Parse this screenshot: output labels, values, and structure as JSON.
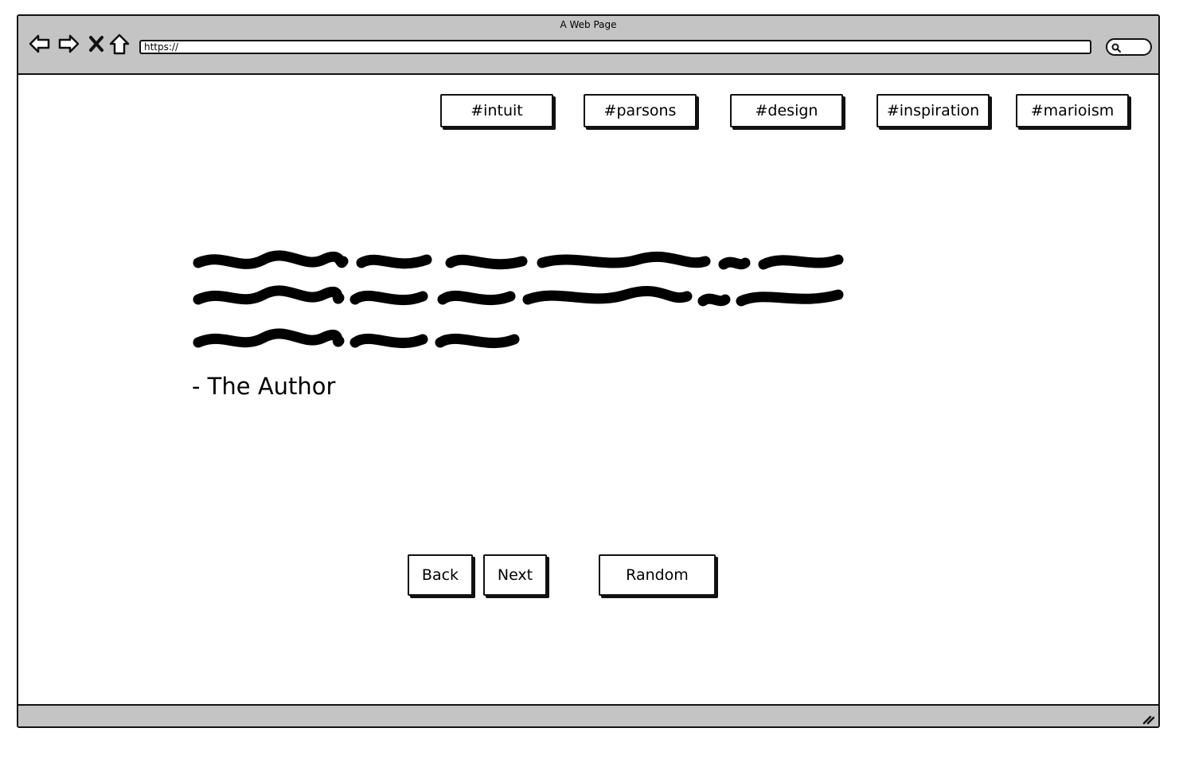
{
  "window": {
    "title": "A Web Page",
    "url": "https://"
  },
  "tags": [
    "#intuit",
    "#parsons",
    "#design",
    "#inspiration",
    "#marioism"
  ],
  "quote": {
    "author": "- The Author"
  },
  "navigation": {
    "back_label": "Back",
    "next_label": "Next",
    "random_label": "Random"
  },
  "icons": {
    "back": "back-arrow-icon",
    "forward": "forward-arrow-icon",
    "stop": "close-icon",
    "home": "home-icon",
    "search": "search-icon",
    "resize": "resize-grip-icon"
  },
  "colors": {
    "chrome": "#c4c4c4",
    "ink": "#111111",
    "page": "#ffffff"
  }
}
